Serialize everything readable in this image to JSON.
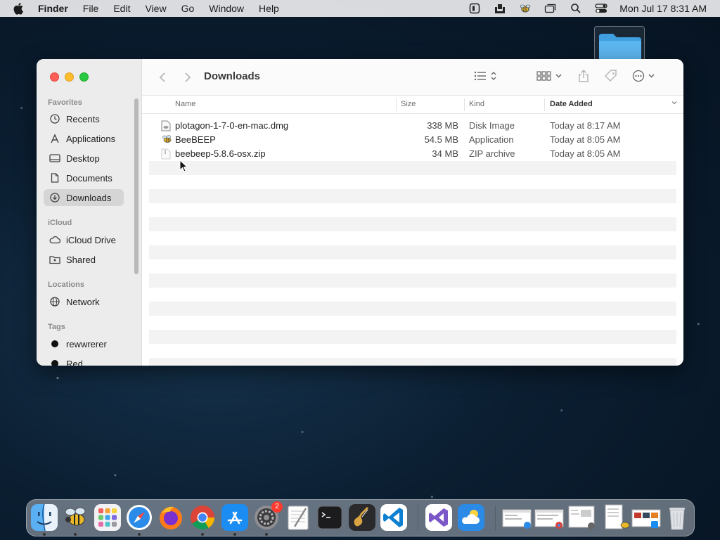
{
  "menubar": {
    "app_name": "Finder",
    "menus": [
      "File",
      "Edit",
      "View",
      "Go",
      "Window",
      "Help"
    ],
    "clock": "Mon Jul 17  8:31 AM"
  },
  "window": {
    "title": "Downloads"
  },
  "sidebar": {
    "favorites_label": "Favorites",
    "favorites": [
      {
        "label": "Recents",
        "icon": "clock-icon"
      },
      {
        "label": "Applications",
        "icon": "applications-icon"
      },
      {
        "label": "Desktop",
        "icon": "desktop-icon"
      },
      {
        "label": "Documents",
        "icon": "document-icon"
      },
      {
        "label": "Downloads",
        "icon": "download-icon",
        "active": true
      }
    ],
    "icloud_label": "iCloud",
    "icloud": [
      {
        "label": "iCloud Drive",
        "icon": "cloud-icon"
      },
      {
        "label": "Shared",
        "icon": "shared-folder-icon"
      }
    ],
    "locations_label": "Locations",
    "locations": [
      {
        "label": "Network",
        "icon": "globe-icon"
      }
    ],
    "tags_label": "Tags",
    "tags": [
      {
        "label": "rewwrerer"
      },
      {
        "label": "Red"
      }
    ]
  },
  "columns": {
    "name": "Name",
    "size": "Size",
    "kind": "Kind",
    "date": "Date Added"
  },
  "files": [
    {
      "name": "plotagon-1-7-0-en-mac.dmg",
      "size": "338 MB",
      "kind": "Disk Image",
      "date": "Today at 8:17 AM"
    },
    {
      "name": "BeeBEEP",
      "size": "54.5 MB",
      "kind": "Application",
      "date": "Today at 8:05 AM"
    },
    {
      "name": "beebeep-5.8.6-osx.zip",
      "size": "34 MB",
      "kind": "ZIP archive",
      "date": "Today at 8:05 AM"
    }
  ],
  "dock": {
    "settings_badge": "2"
  },
  "colors": {
    "close": "#fe5f57",
    "minimize": "#febc2e",
    "zoom": "#28c840",
    "folder": "#4aa8e8"
  }
}
